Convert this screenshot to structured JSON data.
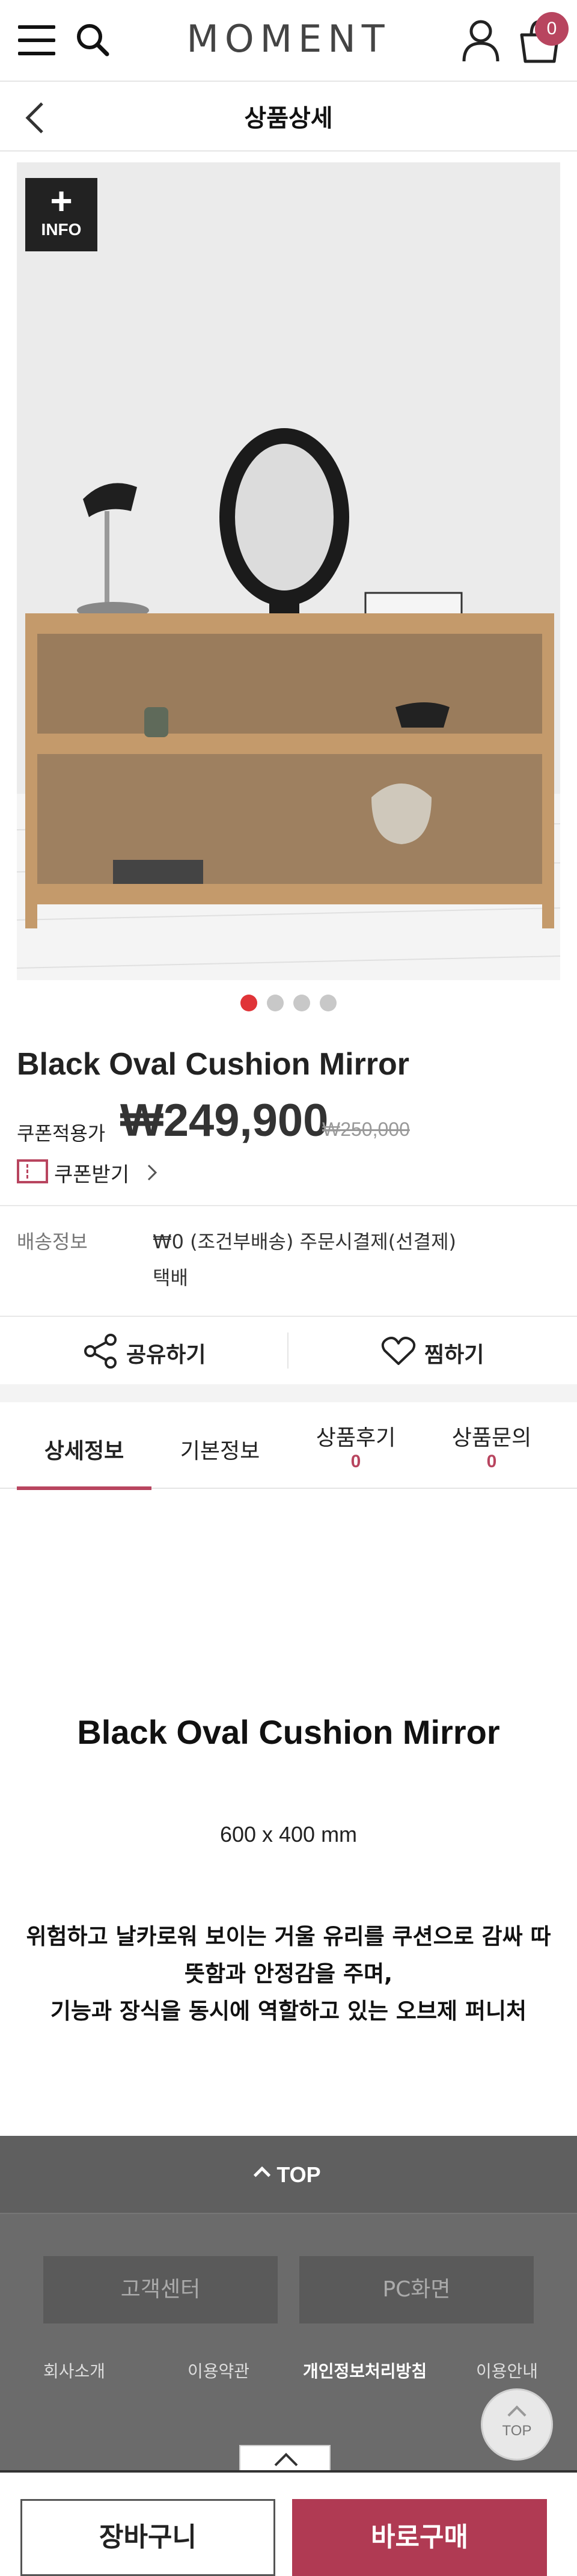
{
  "header": {
    "logo": "MOMENT",
    "cart_count": "0",
    "colors": {
      "badge": "#b8455f"
    }
  },
  "subheader": {
    "title": "상품상세"
  },
  "gallery": {
    "info_plus": "+",
    "info_label": "INFO",
    "slide_count": 4,
    "active_slide": 1,
    "image_subject": "oak double-shelf console with black oval cushion mirror, black desk lamp, bowls and books"
  },
  "product": {
    "name": "Black Oval Cushion Mirror",
    "coupon_price_label": "쿠폰적용가",
    "price": "₩249,900",
    "original_price": "₩250,000",
    "coupon_label": "쿠폰받기"
  },
  "shipping": {
    "label": "배송정보",
    "value": "₩0 (조건부배송) 주문시결제(선결제)",
    "method": "택배"
  },
  "actions": {
    "share": "공유하기",
    "wish": "찜하기"
  },
  "tabs": [
    {
      "label": "상세정보",
      "count": ""
    },
    {
      "label": "기본정보",
      "count": ""
    },
    {
      "label": "상품후기",
      "count": "0"
    },
    {
      "label": "상품문의",
      "count": "0"
    }
  ],
  "detail": {
    "title": "Black Oval Cushion Mirror",
    "size": "600 x 400 mm",
    "desc_line1": "위험하고 날카로워 보이는 거울 유리를 쿠션으로 감싸 따",
    "desc_line2": "뜻함과 안정감을 주며,",
    "desc_line3": "기능과 장식을 동시에 역할하고 있는 오브제 퍼니처"
  },
  "footer": {
    "top_label": "TOP",
    "customer_center": "고객센터",
    "pc_view": "PC화면",
    "links": [
      "회사소개",
      "이용약관",
      "개인정보처리방침",
      "이용안내"
    ],
    "float_top": "TOP"
  },
  "bottom": {
    "cart": "장바구니",
    "buy": "바로구매",
    "buy_color": "#b03a53"
  }
}
